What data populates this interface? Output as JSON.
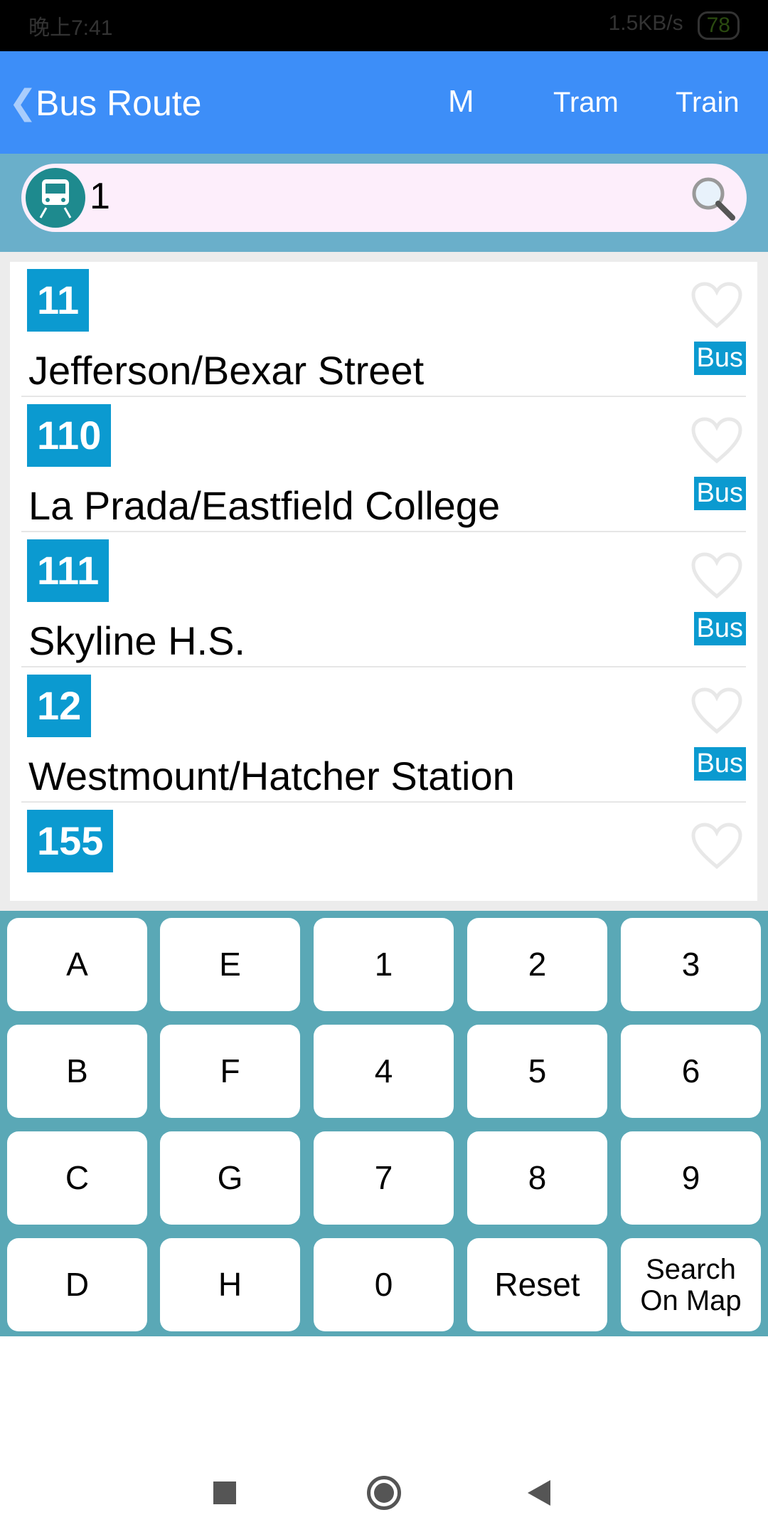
{
  "status_bar": {
    "time": "晚上7:41",
    "speed": "1.5KB/s",
    "battery": "78"
  },
  "header": {
    "back_icon": "chevron-left",
    "title": "Bus Route",
    "metro_label": "M",
    "tram_label": "Tram",
    "train_label": "Train"
  },
  "search": {
    "value": "1",
    "icon": "bus-icon",
    "search_icon": "magnifier-icon"
  },
  "routes": [
    {
      "number": "11",
      "name": "Jefferson/Bexar Street",
      "type": "Bus"
    },
    {
      "number": "110",
      "name": "La Prada/Eastfield College",
      "type": "Bus"
    },
    {
      "number": "111",
      "name": "Skyline H.S.",
      "type": "Bus"
    },
    {
      "number": "12",
      "name": "Westmount/Hatcher Station",
      "type": "Bus"
    },
    {
      "number": "155",
      "name": "",
      "type": ""
    }
  ],
  "keypad": [
    [
      "A",
      "E",
      "1",
      "2",
      "3"
    ],
    [
      "B",
      "F",
      "4",
      "5",
      "6"
    ],
    [
      "C",
      "G",
      "7",
      "8",
      "9"
    ],
    [
      "D",
      "H",
      "0",
      "Reset",
      "Search On Map"
    ]
  ],
  "colors": {
    "header": "#3d8ef8",
    "badge": "#0b9ad0",
    "keypad": "#5aa8b6",
    "search_bg": "#6aafca"
  }
}
